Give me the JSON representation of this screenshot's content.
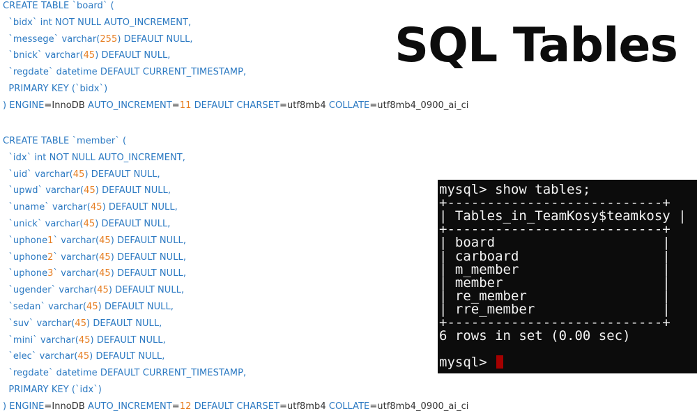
{
  "heading": "SQL Tables",
  "sql": {
    "board": [
      "CREATE TABLE `board` (",
      "  `bidx` int NOT NULL AUTO_INCREMENT,",
      "  `messege` varchar(255) DEFAULT NULL,",
      "  `bnick` varchar(45) DEFAULT NULL,",
      "  `regdate` datetime DEFAULT CURRENT_TIMESTAMP,",
      "  PRIMARY KEY (`bidx`)",
      ") ENGINE=InnoDB AUTO_INCREMENT=11 DEFAULT CHARSET=utf8mb4 COLLATE=utf8mb4_0900_ai_ci"
    ],
    "member": [
      "CREATE TABLE `member` (",
      "  `idx` int NOT NULL AUTO_INCREMENT,",
      "  `uid` varchar(45) DEFAULT NULL,",
      "  `upwd` varchar(45) DEFAULT NULL,",
      "  `uname` varchar(45) DEFAULT NULL,",
      "  `unick` varchar(45) DEFAULT NULL,",
      "  `uphone1` varchar(45) DEFAULT NULL,",
      "  `uphone2` varchar(45) DEFAULT NULL,",
      "  `uphone3` varchar(45) DEFAULT NULL,",
      "  `ugender` varchar(45) DEFAULT NULL,",
      "  `sedan` varchar(45) DEFAULT NULL,",
      "  `suv` varchar(45) DEFAULT NULL,",
      "  `mini` varchar(45) DEFAULT NULL,",
      "  `elec` varchar(45) DEFAULT NULL,",
      "  `regdate` datetime DEFAULT CURRENT_TIMESTAMP,",
      "  PRIMARY KEY (`idx`)",
      ") ENGINE=InnoDB AUTO_INCREMENT=12 DEFAULT CHARSET=utf8mb4 COLLATE=utf8mb4_0900_ai_ci"
    ]
  },
  "terminal": {
    "lines": [
      "mysql> show tables;",
      "+---------------------------+",
      "| Tables_in_TeamKosy$teamkosy |",
      "+---------------------------+",
      "| board                     |",
      "| carboard                  |",
      "| m_member                  |",
      "| member                    |",
      "| re_member                 |",
      "| rre_member                |",
      "+---------------------------+",
      "6 rows in set (0.00 sec)",
      "",
      "mysql> "
    ]
  },
  "colors": {
    "keyword": "#2b79c2",
    "number": "#e67e22",
    "terminal_bg": "#0c0c0c",
    "cursor": "#a50000"
  }
}
